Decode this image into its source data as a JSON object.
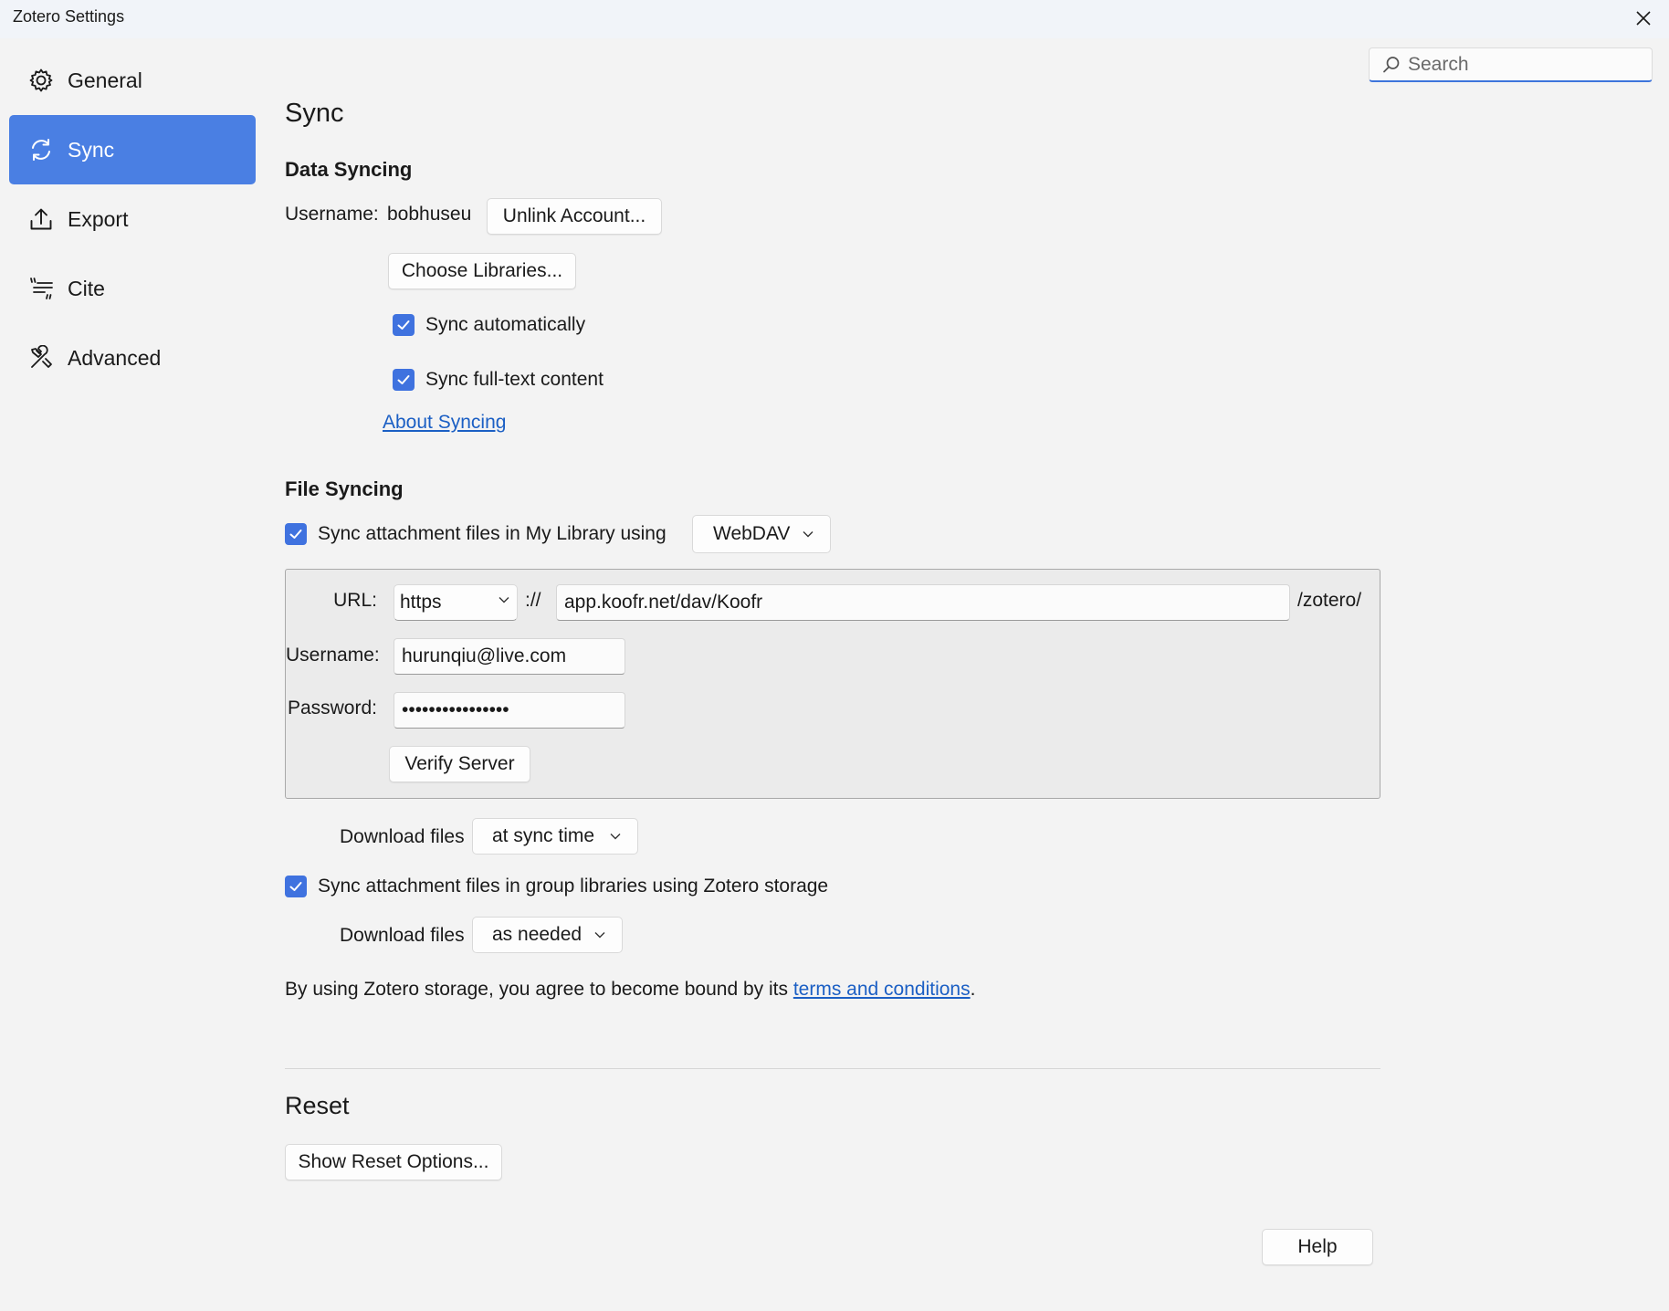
{
  "window": {
    "title": "Zotero Settings"
  },
  "search": {
    "placeholder": "Search"
  },
  "sidebar": {
    "items": [
      {
        "label": "General",
        "icon": "gear-icon"
      },
      {
        "label": "Sync",
        "icon": "sync-icon",
        "active": true
      },
      {
        "label": "Export",
        "icon": "export-icon"
      },
      {
        "label": "Cite",
        "icon": "cite-icon"
      },
      {
        "label": "Advanced",
        "icon": "advanced-icon"
      }
    ]
  },
  "page": {
    "title": "Sync"
  },
  "data_syncing": {
    "heading": "Data Syncing",
    "username_label": "Username:",
    "username_value": "bobhuseu",
    "unlink_label": "Unlink Account...",
    "choose_libraries_label": "Choose Libraries...",
    "sync_auto_label": "Sync automatically",
    "sync_fulltext_label": "Sync full-text content",
    "about_link": "About Syncing"
  },
  "file_syncing": {
    "heading": "File Syncing",
    "sync_my_library_label": "Sync attachment files in My Library using",
    "method_value": "WebDAV",
    "url_label": "URL:",
    "protocol_value": "https",
    "protocol_sep": "://",
    "url_value": "app.koofr.net/dav/Koofr",
    "url_suffix": "/zotero/",
    "username_label": "Username:",
    "username_value": "hurunqiu@live.com",
    "password_label": "Password:",
    "password_value": "••••••••••••••••",
    "verify_label": "Verify Server",
    "download_label": "Download files",
    "download_value": "at sync time",
    "sync_group_label": "Sync attachment files in group libraries using Zotero storage",
    "group_download_label": "Download files",
    "group_download_value": "as needed",
    "terms_prefix": "By using Zotero storage, you agree to become bound by its ",
    "terms_link": "terms and conditions",
    "terms_suffix": "."
  },
  "reset": {
    "heading": "Reset",
    "show_options_label": "Show Reset Options..."
  },
  "footer": {
    "help_label": "Help"
  },
  "colors": {
    "accent": "#4a7fe3",
    "checkbox": "#3f72df",
    "link": "#1b5fc4"
  }
}
